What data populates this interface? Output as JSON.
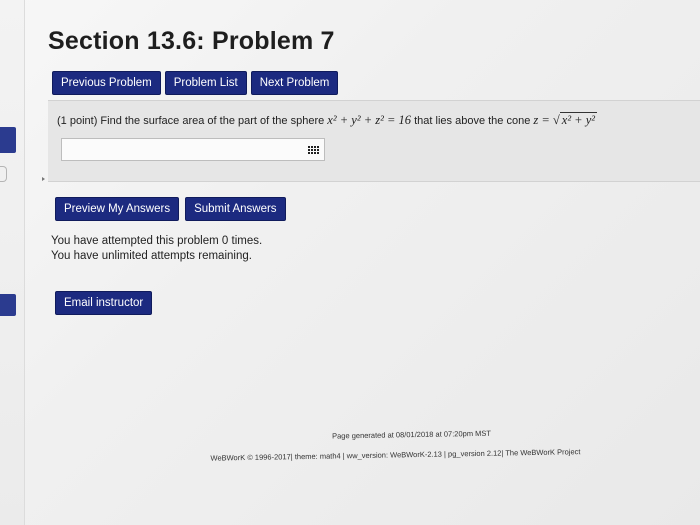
{
  "page_title": "Section 13.6: Problem 7",
  "nav": {
    "previous": "Previous Problem",
    "list": "Problem List",
    "next": "Next Problem"
  },
  "problem": {
    "points": "(1 point)",
    "text_before": "Find the surface area of the part of the sphere",
    "sphere_equation": "x² + y² + z² = 16",
    "text_after": "that lies above the cone",
    "cone_lhs": "z =",
    "cone_radicand": "x² + y²",
    "answer_value": "",
    "answer_placeholder": ""
  },
  "actions": {
    "preview": "Preview My Answers",
    "submit": "Submit Answers"
  },
  "attempts": {
    "line1": "You have attempted this problem 0 times.",
    "line2": "You have unlimited attempts remaining."
  },
  "email_instructor": "Email instructor",
  "footer": {
    "generated": "Page generated at 08/01/2018 at 07:20pm MST",
    "credits": "WeBWorK © 1996-2017| theme: math4 | ww_version: WeBWorK-2.13 | pg_version 2.12| The WeBWorK Project"
  },
  "colors": {
    "button_bg": "#1c2a80",
    "button_text": "#ffffff",
    "problem_box_bg": "#e6e6e6",
    "sidebar_tab": "#2b3b8f"
  },
  "icons": {
    "answer_helper": "grid-icon"
  }
}
